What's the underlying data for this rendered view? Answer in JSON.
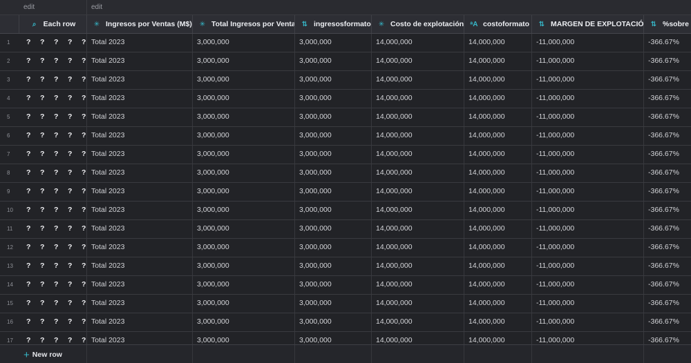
{
  "groups": [
    {
      "label": "edit"
    },
    {
      "label": "edit"
    }
  ],
  "columns": [
    {
      "label": "",
      "icon": ""
    },
    {
      "label": "Each row",
      "icon": "⌕",
      "icon_name": "search-icon"
    },
    {
      "label": "Ingresos por Ventas (M$)",
      "icon": "✳",
      "icon_name": "formula-asterisk-icon"
    },
    {
      "label": "Total Ingresos por Venta",
      "icon": "✳",
      "icon_name": "formula-asterisk-icon"
    },
    {
      "label": "ingresosformato",
      "icon": "⇅",
      "icon_name": "sort-lines-icon"
    },
    {
      "label": "Costo de explotación",
      "icon": "✳",
      "icon_name": "formula-asterisk-icon"
    },
    {
      "label": "costoformato",
      "icon": "ᵃA",
      "icon_name": "text-format-icon"
    },
    {
      "label": "MARGEN DE EXPLOTACIÓN",
      "icon": "⇅",
      "icon_name": "sort-lines-icon"
    },
    {
      "label": "%sobre v",
      "icon": "⇅",
      "icon_name": "sort-lines-icon"
    }
  ],
  "each_row_marks": [
    "?",
    "?",
    "?",
    "?",
    "?"
  ],
  "rows": [
    {
      "n": "1",
      "label": "Total 2023",
      "ingresos": "3,000,000",
      "fmt": "3,000,000",
      "costo": "14,000,000",
      "costofmt": "14,000,000",
      "margen": "-11,000,000",
      "pct": "-366.67%"
    },
    {
      "n": "2",
      "label": "Total 2023",
      "ingresos": "3,000,000",
      "fmt": "3,000,000",
      "costo": "14,000,000",
      "costofmt": "14,000,000",
      "margen": "-11,000,000",
      "pct": "-366.67%"
    },
    {
      "n": "3",
      "label": "Total 2023",
      "ingresos": "3,000,000",
      "fmt": "3,000,000",
      "costo": "14,000,000",
      "costofmt": "14,000,000",
      "margen": "-11,000,000",
      "pct": "-366.67%"
    },
    {
      "n": "4",
      "label": "Total 2023",
      "ingresos": "3,000,000",
      "fmt": "3,000,000",
      "costo": "14,000,000",
      "costofmt": "14,000,000",
      "margen": "-11,000,000",
      "pct": "-366.67%"
    },
    {
      "n": "5",
      "label": "Total 2023",
      "ingresos": "3,000,000",
      "fmt": "3,000,000",
      "costo": "14,000,000",
      "costofmt": "14,000,000",
      "margen": "-11,000,000",
      "pct": "-366.67%"
    },
    {
      "n": "6",
      "label": "Total 2023",
      "ingresos": "3,000,000",
      "fmt": "3,000,000",
      "costo": "14,000,000",
      "costofmt": "14,000,000",
      "margen": "-11,000,000",
      "pct": "-366.67%"
    },
    {
      "n": "7",
      "label": "Total 2023",
      "ingresos": "3,000,000",
      "fmt": "3,000,000",
      "costo": "14,000,000",
      "costofmt": "14,000,000",
      "margen": "-11,000,000",
      "pct": "-366.67%"
    },
    {
      "n": "8",
      "label": "Total 2023",
      "ingresos": "3,000,000",
      "fmt": "3,000,000",
      "costo": "14,000,000",
      "costofmt": "14,000,000",
      "margen": "-11,000,000",
      "pct": "-366.67%"
    },
    {
      "n": "9",
      "label": "Total 2023",
      "ingresos": "3,000,000",
      "fmt": "3,000,000",
      "costo": "14,000,000",
      "costofmt": "14,000,000",
      "margen": "-11,000,000",
      "pct": "-366.67%"
    },
    {
      "n": "10",
      "label": "Total 2023",
      "ingresos": "3,000,000",
      "fmt": "3,000,000",
      "costo": "14,000,000",
      "costofmt": "14,000,000",
      "margen": "-11,000,000",
      "pct": "-366.67%"
    },
    {
      "n": "11",
      "label": "Total 2023",
      "ingresos": "3,000,000",
      "fmt": "3,000,000",
      "costo": "14,000,000",
      "costofmt": "14,000,000",
      "margen": "-11,000,000",
      "pct": "-366.67%"
    },
    {
      "n": "12",
      "label": "Total 2023",
      "ingresos": "3,000,000",
      "fmt": "3,000,000",
      "costo": "14,000,000",
      "costofmt": "14,000,000",
      "margen": "-11,000,000",
      "pct": "-366.67%"
    },
    {
      "n": "13",
      "label": "Total 2023",
      "ingresos": "3,000,000",
      "fmt": "3,000,000",
      "costo": "14,000,000",
      "costofmt": "14,000,000",
      "margen": "-11,000,000",
      "pct": "-366.67%"
    },
    {
      "n": "14",
      "label": "Total 2023",
      "ingresos": "3,000,000",
      "fmt": "3,000,000",
      "costo": "14,000,000",
      "costofmt": "14,000,000",
      "margen": "-11,000,000",
      "pct": "-366.67%"
    },
    {
      "n": "15",
      "label": "Total 2023",
      "ingresos": "3,000,000",
      "fmt": "3,000,000",
      "costo": "14,000,000",
      "costofmt": "14,000,000",
      "margen": "-11,000,000",
      "pct": "-366.67%"
    },
    {
      "n": "16",
      "label": "Total 2023",
      "ingresos": "3,000,000",
      "fmt": "3,000,000",
      "costo": "14,000,000",
      "costofmt": "14,000,000",
      "margen": "-11,000,000",
      "pct": "-366.67%"
    },
    {
      "n": "17",
      "label": "Total 2023",
      "ingresos": "3,000,000",
      "fmt": "3,000,000",
      "costo": "14,000,000",
      "costofmt": "14,000,000",
      "margen": "-11,000,000",
      "pct": "-366.67%"
    }
  ],
  "footer": {
    "new_row_label": "New row",
    "plus_icon": "+"
  },
  "colors": {
    "accent": "#36b8c9",
    "background": "#222327",
    "header": "#2d2e34"
  }
}
